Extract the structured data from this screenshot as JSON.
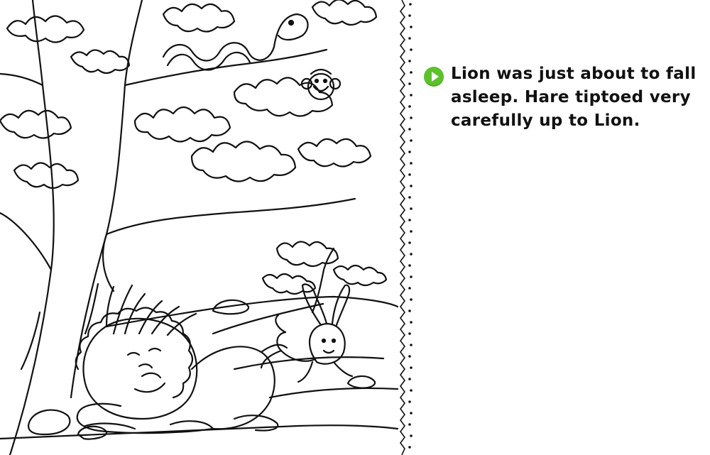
{
  "page": {
    "narration": "Lion was just about to fall asleep. Hare tiptoed very carefully up to Lion.",
    "play_icon": "play-icon",
    "accent_color": "#5cc22c"
  },
  "illustration": {
    "subjects": [
      "lion",
      "hare",
      "monkey",
      "snake",
      "tree"
    ]
  }
}
